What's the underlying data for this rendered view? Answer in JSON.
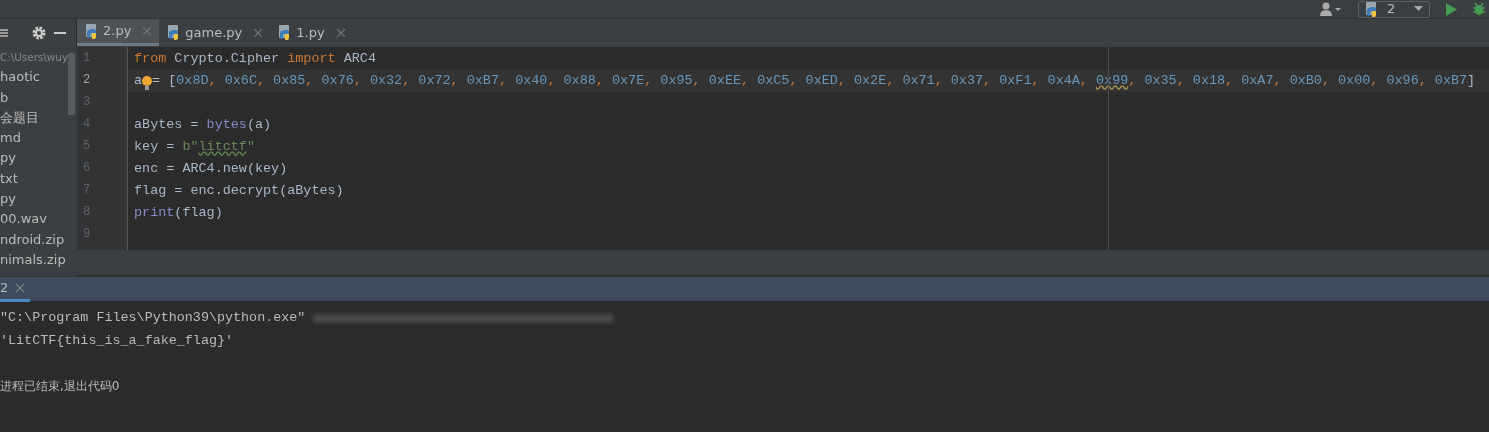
{
  "toolbar": {
    "run_config": "2"
  },
  "project_panel": {
    "items": [
      {
        "text": "C:\\Users\\wuy",
        "kind": "path"
      },
      {
        "text": "haotic",
        "kind": "file"
      },
      {
        "text": "b",
        "kind": "file"
      },
      {
        "text": "会题目",
        "kind": "file"
      },
      {
        "text": "md",
        "kind": "file"
      },
      {
        "text": "py",
        "kind": "file"
      },
      {
        "text": "txt",
        "kind": "file"
      },
      {
        "text": "py",
        "kind": "file"
      },
      {
        "text": "00.wav",
        "kind": "file"
      },
      {
        "text": "ndroid.zip",
        "kind": "file"
      },
      {
        "text": "nimals.zip",
        "kind": "file"
      }
    ]
  },
  "tabs": [
    {
      "label": "2.py",
      "selected": true
    },
    {
      "label": "game.py",
      "selected": false
    },
    {
      "label": "1.py",
      "selected": false
    }
  ],
  "editor": {
    "lines": [
      {
        "number": "1",
        "current": false,
        "tokens": [
          {
            "text": "from",
            "kind": "keyword"
          },
          {
            "text": " Crypto.Cipher ",
            "kind": "plain"
          },
          {
            "text": "import",
            "kind": "keyword"
          },
          {
            "text": " ARC4",
            "kind": "plain"
          }
        ]
      },
      {
        "number": "2",
        "current": true,
        "tokens": [
          {
            "text": "a",
            "kind": "plain"
          },
          {
            "text": "= [",
            "kind": "plain"
          },
          {
            "text": "0x8D",
            "kind": "number"
          },
          {
            "text": ", ",
            "kind": "punct"
          },
          {
            "text": "0x6C",
            "kind": "number"
          },
          {
            "text": ", ",
            "kind": "punct"
          },
          {
            "text": "0x85",
            "kind": "number"
          },
          {
            "text": ", ",
            "kind": "punct"
          },
          {
            "text": "0x76",
            "kind": "number"
          },
          {
            "text": ", ",
            "kind": "punct"
          },
          {
            "text": "0x32",
            "kind": "number"
          },
          {
            "text": ", ",
            "kind": "punct"
          },
          {
            "text": "0x72",
            "kind": "number"
          },
          {
            "text": ", ",
            "kind": "punct"
          },
          {
            "text": "0xB7",
            "kind": "number"
          },
          {
            "text": ", ",
            "kind": "punct"
          },
          {
            "text": "0x40",
            "kind": "number"
          },
          {
            "text": ", ",
            "kind": "punct"
          },
          {
            "text": "0x88",
            "kind": "number"
          },
          {
            "text": ", ",
            "kind": "punct"
          },
          {
            "text": "0x7E",
            "kind": "number"
          },
          {
            "text": ", ",
            "kind": "punct"
          },
          {
            "text": "0x95",
            "kind": "number"
          },
          {
            "text": ", ",
            "kind": "punct"
          },
          {
            "text": "0xEE",
            "kind": "number"
          },
          {
            "text": ", ",
            "kind": "punct"
          },
          {
            "text": "0xC5",
            "kind": "number"
          },
          {
            "text": ", ",
            "kind": "punct"
          },
          {
            "text": "0xED",
            "kind": "number"
          },
          {
            "text": ", ",
            "kind": "punct"
          },
          {
            "text": "0x2E",
            "kind": "number"
          },
          {
            "text": ", ",
            "kind": "punct"
          },
          {
            "text": "0x71",
            "kind": "number"
          },
          {
            "text": ", ",
            "kind": "punct"
          },
          {
            "text": "0x37",
            "kind": "number"
          },
          {
            "text": ", ",
            "kind": "punct"
          },
          {
            "text": "0xF1",
            "kind": "number"
          },
          {
            "text": ", ",
            "kind": "punct"
          },
          {
            "text": "0x4A",
            "kind": "number"
          },
          {
            "text": ", ",
            "kind": "punct"
          },
          {
            "text": "0x99",
            "kind": "warn"
          },
          {
            "text": ", ",
            "kind": "punct"
          },
          {
            "text": "0x35",
            "kind": "number"
          },
          {
            "text": ", ",
            "kind": "punct"
          },
          {
            "text": "0x18",
            "kind": "number"
          },
          {
            "text": ", ",
            "kind": "punct"
          },
          {
            "text": "0xA7",
            "kind": "number"
          },
          {
            "text": ", ",
            "kind": "punct"
          },
          {
            "text": "0xB0",
            "kind": "number"
          },
          {
            "text": ", ",
            "kind": "punct"
          },
          {
            "text": "0x00",
            "kind": "number"
          },
          {
            "text": ", ",
            "kind": "punct"
          },
          {
            "text": "0x96",
            "kind": "number"
          },
          {
            "text": ", ",
            "kind": "punct"
          },
          {
            "text": "0xB7",
            "kind": "number"
          },
          {
            "text": "]",
            "kind": "plain"
          }
        ]
      },
      {
        "number": "3",
        "current": false
      },
      {
        "number": "4",
        "current": false,
        "tokens": [
          {
            "text": "aBytes = ",
            "kind": "plain"
          },
          {
            "text": "bytes",
            "kind": "builtin"
          },
          {
            "text": "(a)",
            "kind": "plain"
          }
        ]
      },
      {
        "number": "5",
        "current": false,
        "tokens": [
          {
            "text": "key = ",
            "kind": "plain"
          },
          {
            "text": "b\"",
            "kind": "string"
          },
          {
            "text": "litctf",
            "kind": "typo"
          },
          {
            "text": "\"",
            "kind": "string"
          }
        ]
      },
      {
        "number": "6",
        "current": false,
        "tokens": [
          {
            "text": "enc = ARC4.new(key)",
            "kind": "plain"
          }
        ]
      },
      {
        "number": "7",
        "current": false,
        "tokens": [
          {
            "text": "flag = enc.decrypt(aBytes)",
            "kind": "plain"
          }
        ]
      },
      {
        "number": "8",
        "current": false,
        "tokens": [
          {
            "text": "print",
            "kind": "builtin"
          },
          {
            "text": "(flag)",
            "kind": "plain"
          }
        ]
      },
      {
        "number": "9",
        "current": false
      }
    ]
  },
  "run_panel": {
    "tab": {
      "label": "2",
      "selected": true
    },
    "output": [
      {
        "text": "\"C:\\Program Files\\Python39\\python.exe\"",
        "redacted": true
      },
      {
        "text": "'LitCTF{this_is_a_fake_flag}'",
        "redacted": false
      },
      {
        "text": "进程已结束,退出代码0",
        "redacted": false
      }
    ]
  }
}
